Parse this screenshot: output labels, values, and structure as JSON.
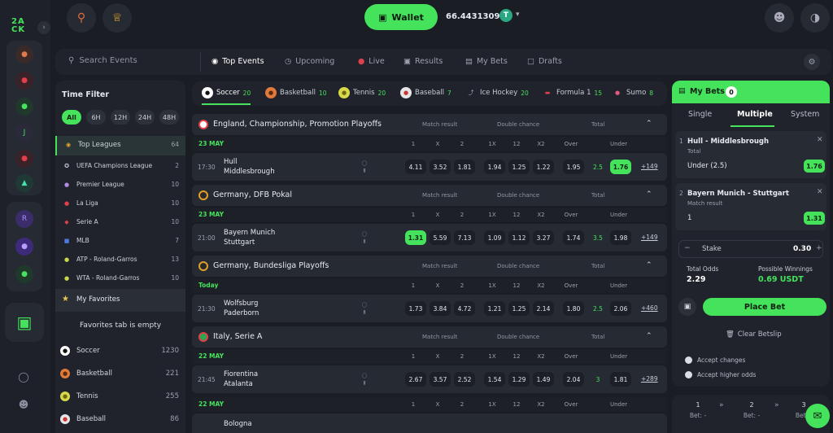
{
  "brand": {
    "logo_top": "2A",
    "logo_bottom": "CK",
    "accent": "#45e35c"
  },
  "wallet": {
    "label": "Wallet",
    "balance": "66.44313094",
    "currency": "T"
  },
  "nav": {
    "search_placeholder": "Search Events",
    "tabs": [
      {
        "label": "Top Events",
        "icon": "trophy-icon"
      },
      {
        "label": "Upcoming",
        "icon": "clock-icon"
      },
      {
        "label": "Live",
        "icon": "live-dot-icon"
      },
      {
        "label": "Results",
        "icon": "results-icon"
      },
      {
        "label": "My Bets",
        "icon": "ticket-icon"
      },
      {
        "label": "Drafts",
        "icon": "draft-icon"
      }
    ]
  },
  "time_filter": {
    "title": "Time Filter",
    "options": [
      "All",
      "6H",
      "12H",
      "24H",
      "48H"
    ],
    "selected": "All",
    "leagues": [
      {
        "name": "Top Leagues",
        "count": "64"
      },
      {
        "name": "UEFA Champions League",
        "count": "2"
      },
      {
        "name": "Premier League",
        "count": "10"
      },
      {
        "name": "La Liga",
        "count": "10"
      },
      {
        "name": "Serie A",
        "count": "10"
      },
      {
        "name": "MLB",
        "count": "7"
      },
      {
        "name": "ATP - Roland-Garros",
        "count": "13"
      },
      {
        "name": "WTA - Roland-Garros",
        "count": "10"
      }
    ],
    "favorites_label": "My Favorites",
    "favorites_empty": "Favorites tab is empty",
    "sports": [
      {
        "name": "Soccer",
        "count": "1230"
      },
      {
        "name": "Basketball",
        "count": "221"
      },
      {
        "name": "Tennis",
        "count": "255"
      },
      {
        "name": "Baseball",
        "count": "86"
      }
    ]
  },
  "sport_tabs": [
    {
      "name": "Soccer",
      "count": "20"
    },
    {
      "name": "Basketball",
      "count": "10"
    },
    {
      "name": "Tennis",
      "count": "20"
    },
    {
      "name": "Baseball",
      "count": "7"
    },
    {
      "name": "Ice Hockey",
      "count": "20"
    },
    {
      "name": "Formula 1",
      "count": "15"
    },
    {
      "name": "Sumo",
      "count": "8"
    }
  ],
  "market_headers": {
    "match_result": "Match result",
    "double_chance": "Double chance",
    "total": "Total"
  },
  "col_labels": [
    "1",
    "X",
    "2",
    "1X",
    "12",
    "X2",
    "Over",
    "",
    "Under"
  ],
  "events": [
    {
      "league": "England, Championship, Promotion Playoffs",
      "date": "23 MAY",
      "match": {
        "time": "17:30",
        "home": "Hull",
        "away": "Middlesbrough",
        "odds": [
          "4.11",
          "3.52",
          "1.81",
          "1.94",
          "1.25",
          "1.22",
          "1.95",
          "1.76"
        ],
        "line": "2.5",
        "more": "+149"
      }
    },
    {
      "league": "Germany, DFB Pokal",
      "date": "23 MAY",
      "match": {
        "time": "21:00",
        "home": "Bayern Munich",
        "away": "Stuttgart",
        "odds": [
          "1.31",
          "5.59",
          "7.13",
          "1.09",
          "1.12",
          "3.27",
          "1.74",
          "1.98"
        ],
        "line": "3.5",
        "more": "+149"
      }
    },
    {
      "league": "Germany, Bundesliga Playoffs",
      "date": "Today",
      "match": {
        "time": "21:30",
        "home": "Wolfsburg",
        "away": "Paderborn",
        "odds": [
          "1.73",
          "3.84",
          "4.72",
          "1.21",
          "1.25",
          "2.14",
          "1.80",
          "2.06"
        ],
        "line": "2.5",
        "more": "+460"
      }
    },
    {
      "league": "Italy, Serie A",
      "date": "22 MAY",
      "match": {
        "time": "21:45",
        "home": "Fiorentina",
        "away": "Atalanta",
        "odds": [
          "2.67",
          "3.57",
          "2.52",
          "1.54",
          "1.29",
          "1.49",
          "2.04",
          "1.81"
        ],
        "line": "3",
        "more": "+289"
      }
    }
  ],
  "extra": {
    "date": "22 MAY",
    "home": "Bologna"
  },
  "betslip": {
    "title": "My Bets",
    "count": "0",
    "tabs": [
      "Single",
      "Multiple",
      "System"
    ],
    "active_tab": "Multiple",
    "bets": [
      {
        "num": "1",
        "match": "Hull - Middlesbrough",
        "market": "Total",
        "selection": "Under (2.5)",
        "odds": "1.76"
      },
      {
        "num": "2",
        "match": "Bayern Munich - Stuttgart",
        "market": "Match result",
        "selection": "1",
        "odds": "1.31"
      }
    ],
    "stake_label": "Stake",
    "stake_value": "0.30",
    "total_odds_label": "Total Odds",
    "total_odds": "2.29",
    "winnings_label": "Possible Winnings",
    "winnings": "0.69 USDT",
    "place_label": "Place Bet",
    "clear_label": "Clear Betslip",
    "accept_changes": "Accept changes",
    "accept_higher": "Accept higher odds"
  },
  "steps": [
    {
      "n": "1",
      "bet": "Bet: -"
    },
    {
      "n": "2",
      "bet": "Bet: -"
    },
    {
      "n": "3",
      "bet": "Bet: -"
    }
  ]
}
